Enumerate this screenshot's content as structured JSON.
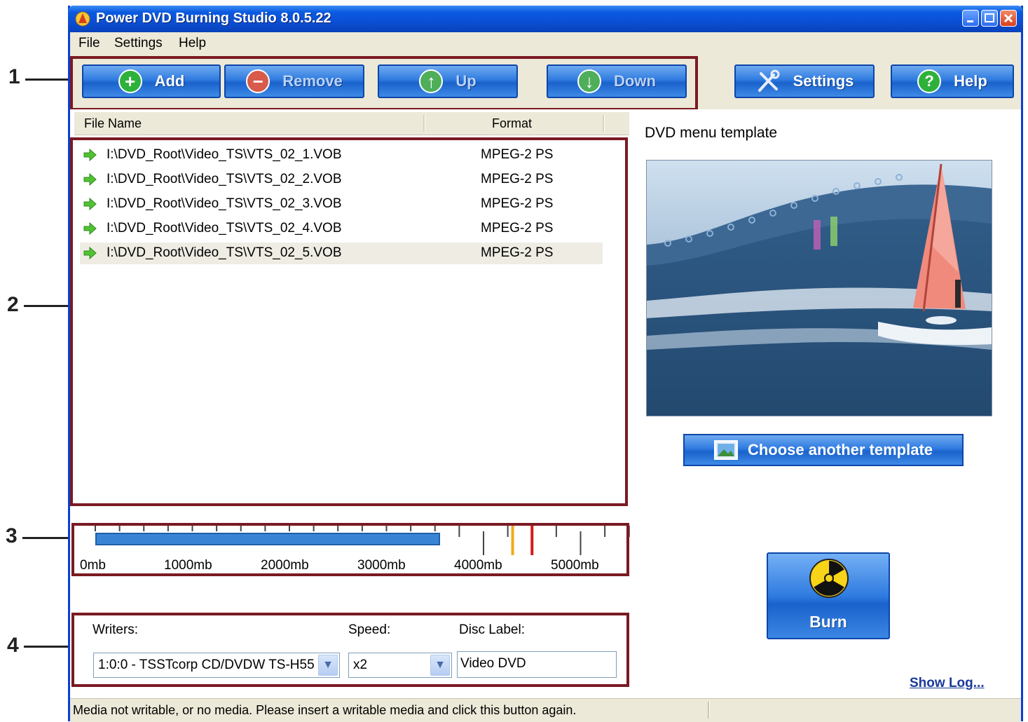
{
  "window": {
    "title": "Power DVD Burning Studio 8.0.5.22"
  },
  "menu": {
    "items": [
      "File",
      "Settings",
      "Help"
    ]
  },
  "callouts": [
    "1",
    "2",
    "3",
    "4"
  ],
  "toolbar": {
    "add_label": "Add",
    "remove_label": "Remove",
    "up_label": "Up",
    "down_label": "Down",
    "settings_label": "Settings",
    "help_label": "Help"
  },
  "file_list": {
    "columns": [
      "File Name",
      "Format"
    ],
    "rows": [
      {
        "name": "I:\\DVD_Root\\Video_TS\\VTS_02_1.VOB",
        "format": "MPEG-2 PS"
      },
      {
        "name": "I:\\DVD_Root\\Video_TS\\VTS_02_2.VOB",
        "format": "MPEG-2 PS"
      },
      {
        "name": "I:\\DVD_Root\\Video_TS\\VTS_02_3.VOB",
        "format": "MPEG-2 PS"
      },
      {
        "name": "I:\\DVD_Root\\Video_TS\\VTS_02_4.VOB",
        "format": "MPEG-2 PS"
      },
      {
        "name": "I:\\DVD_Root\\Video_TS\\VTS_02_5.VOB",
        "format": "MPEG-2 PS",
        "selected": true
      }
    ]
  },
  "template": {
    "title": "DVD menu template",
    "choose_label": "Choose another template"
  },
  "size_meter": {
    "labels": [
      "0mb",
      "1000mb",
      "2000mb",
      "3000mb",
      "4000mb",
      "5000mb"
    ],
    "used_mb": 3550,
    "warning_mark_mb": 4300,
    "limit_mark_mb": 4500,
    "colors": {
      "bar": "#3a84d6",
      "warning": "#f0a81c",
      "limit": "#d41a1a"
    }
  },
  "writer": {
    "writers_label": "Writers:",
    "writer_value": "1:0:0 - TSSTcorp CD/DVDW TS-H55",
    "speed_label": "Speed:",
    "speed_value": "x2",
    "disc_label_label": "Disc Label:",
    "disc_label_value": "Video DVD"
  },
  "burn": {
    "label": "Burn"
  },
  "show_log": "Show Log...",
  "status": {
    "text": "Media not writable, or no media. Please insert a writable media and click this button again."
  },
  "colors": {
    "accent": "#0b4fd6",
    "callout_border": "#7a1a22",
    "link": "#1a3a9a"
  }
}
